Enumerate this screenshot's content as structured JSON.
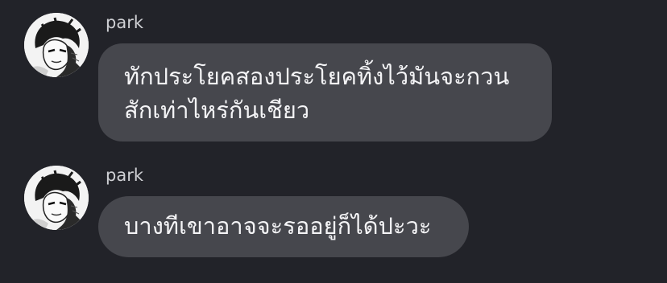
{
  "messages": [
    {
      "sender": "park",
      "avatar_icon": "user-avatar-sketch",
      "lines": [
        "ทักประโยคสองประโยคทิ้งไว้มันจะกวน",
        "สักเท่าไหร่กันเชียว"
      ]
    },
    {
      "sender": "park",
      "avatar_icon": "user-avatar-sketch",
      "lines": [
        "บางทีเขาอาจจะรออยู่ก็ได้ปะวะ"
      ]
    }
  ],
  "colors": {
    "background": "#222329",
    "bubble": "#46474d",
    "sender_text": "#cfd0d4",
    "message_text": "#f4f4f6"
  }
}
